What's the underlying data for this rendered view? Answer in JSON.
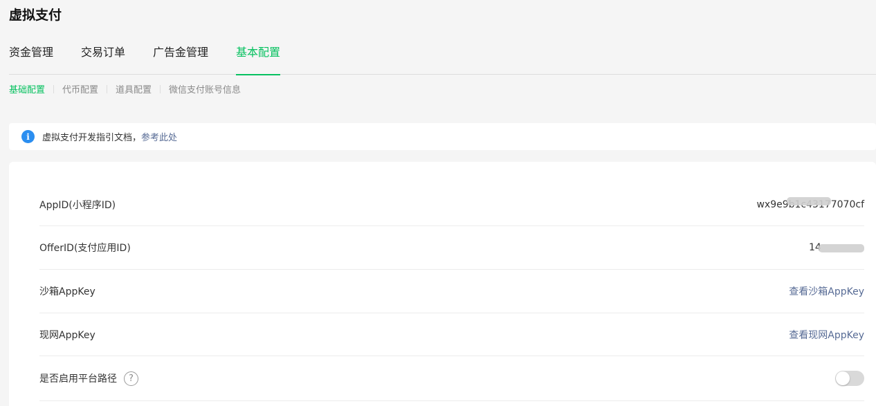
{
  "page_title": "虚拟支付",
  "main_tabs": [
    {
      "label": "资金管理"
    },
    {
      "label": "交易订单"
    },
    {
      "label": "广告金管理"
    },
    {
      "label": "基本配置"
    }
  ],
  "active_main_tab": "基本配置",
  "sub_tabs": [
    {
      "label": "基础配置"
    },
    {
      "label": "代币配置"
    },
    {
      "label": "道具配置"
    },
    {
      "label": "微信支付账号信息"
    }
  ],
  "active_sub_tab": "基础配置",
  "notice": {
    "text": "虚拟支付开发指引文档，",
    "link": "参考此处"
  },
  "settings": {
    "appid": {
      "label": "AppID(小程序ID)",
      "value": "wx9e9b1c43177070cf"
    },
    "offerid": {
      "label": "OfferID(支付应用ID)",
      "value": "14"
    },
    "sandbox_appkey": {
      "label": "沙箱AppKey",
      "link": "查看沙箱AppKey"
    },
    "live_appkey": {
      "label": "现网AppKey",
      "link": "查看现网AppKey"
    },
    "platform_path": {
      "label": "是否启用平台路径",
      "help": "?",
      "enabled": false
    }
  },
  "colors": {
    "accent": "#07c160",
    "link": "#576b95",
    "info": "#2b8ef0"
  }
}
